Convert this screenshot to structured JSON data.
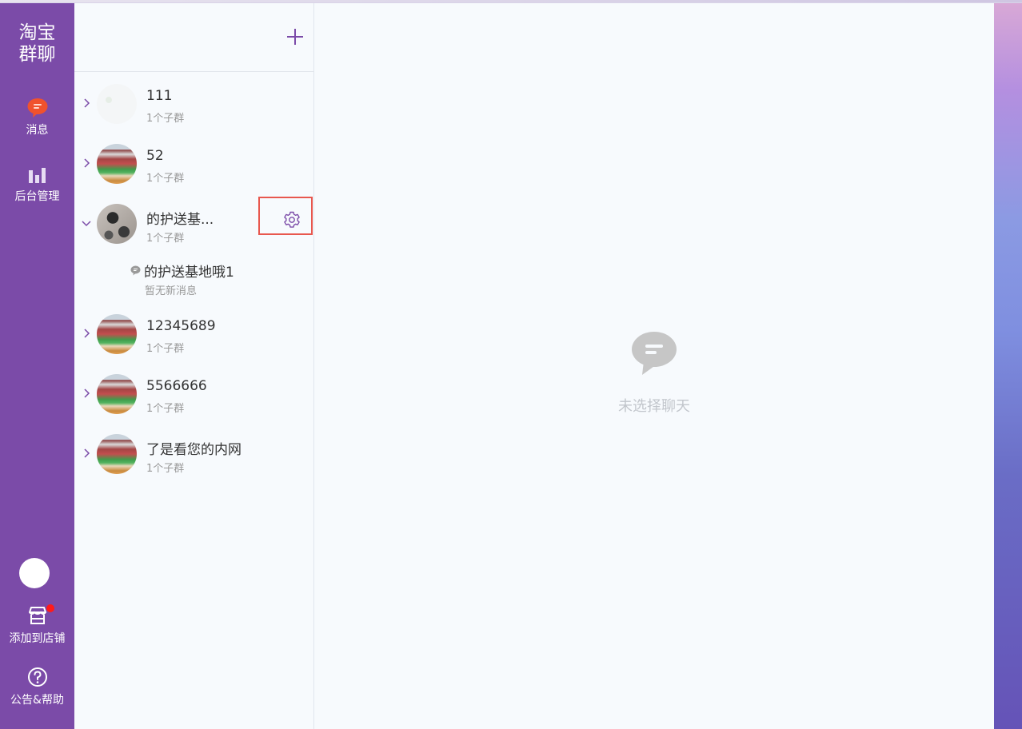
{
  "nav": {
    "brand": "淘宝\n群聊",
    "brand_line1": "淘宝",
    "brand_line2": "群聊",
    "messages_label": "消息",
    "admin_label": "后台管理",
    "add_to_shop_label": "添加到店铺",
    "help_label": "公告&帮助"
  },
  "groups": [
    {
      "name": "111",
      "subtitle": "1个子群",
      "expanded": false
    },
    {
      "name": "52",
      "subtitle": "1个子群",
      "expanded": false
    },
    {
      "name": "的护送基...",
      "subtitle": "1个子群",
      "expanded": true,
      "subgroups": [
        {
          "name": "的护送基地哦1",
          "status": "暂无新消息"
        }
      ]
    },
    {
      "name": "12345689",
      "subtitle": "1个子群",
      "expanded": false
    },
    {
      "name": "5566666",
      "subtitle": "1个子群",
      "expanded": false
    },
    {
      "name": "了是看您的内网",
      "subtitle": "1个子群",
      "expanded": false
    }
  ],
  "main": {
    "empty_text": "未选择聊天"
  },
  "colors": {
    "nav_bg": "#7b4ba8",
    "accent": "#7b4ba8",
    "message_icon": "#f0522d",
    "highlight_border": "#e8574e",
    "badge": "#ff1a1a"
  },
  "icons": {
    "messages": "chat-bubble-icon",
    "admin": "bar-chart-icon",
    "shop": "store-icon",
    "help": "question-circle-icon",
    "add": "plus-icon",
    "settings": "gear-icon",
    "empty": "chat-bubble-icon"
  }
}
